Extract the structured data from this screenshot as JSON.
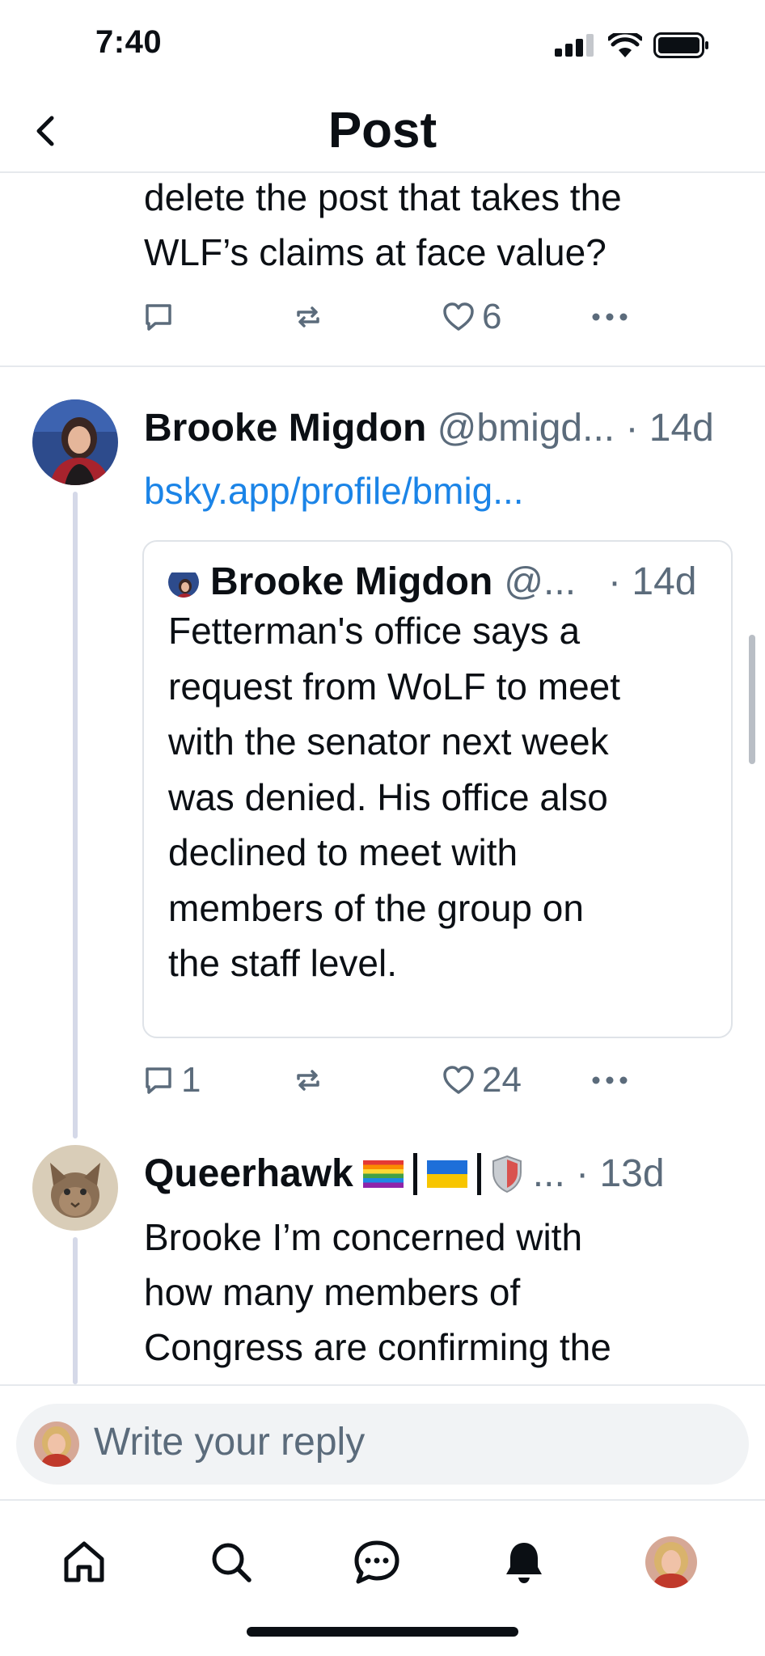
{
  "status_bar": {
    "time": "7:40"
  },
  "header": {
    "title": "Post"
  },
  "previous_post": {
    "lines": [
      "delete the post that takes the",
      "WLF’s claims at face value?"
    ],
    "like_count": "6"
  },
  "reply_1": {
    "display_name": "Brooke Migdon",
    "handle": "@bmigd...",
    "time": "· 14d",
    "link": "bsky.app/profile/bmig...",
    "quote": {
      "display_name": "Brooke Migdon",
      "handle": "@...",
      "time": "· 14d",
      "lines": [
        "Fetterman's office says a",
        "request from WoLF to meet",
        "with the senator next week",
        "was denied. His office also",
        "declined to meet with",
        "members of the group on",
        "the staff level."
      ]
    },
    "reply_count": "1",
    "like_count": "24"
  },
  "reply_2": {
    "display_name": "Queerhawk",
    "name_suffix": "... · 13d",
    "lines": [
      "Brooke I’m concerned with",
      "how many members of",
      "Congress are confirming the"
    ]
  },
  "composer": {
    "placeholder": "Write your reply"
  },
  "tabs": [
    "home-icon",
    "search-icon",
    "chat-icon",
    "bell-icon",
    "profile-avatar"
  ],
  "colors": {
    "link": "#1b84e7",
    "muted": "#5b6b7b",
    "thread_line": "#d5d9e8"
  }
}
